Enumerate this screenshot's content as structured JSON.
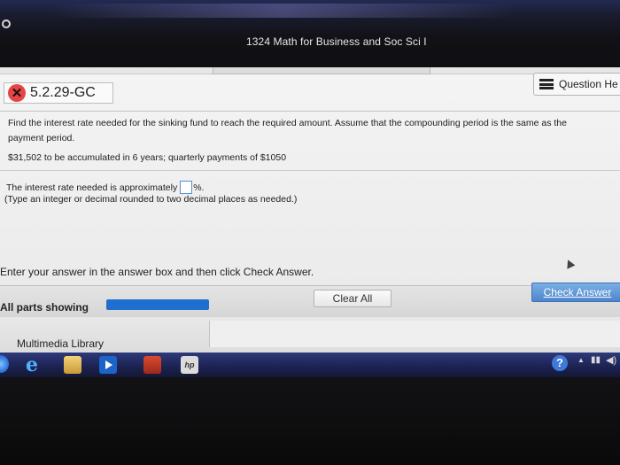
{
  "window": {
    "course_title": "1324 Math for Business and Soc Sci I"
  },
  "question": {
    "id": "5.2.29-GC",
    "status_icon": "x-circle-icon",
    "help_label": "Question He",
    "instruction_line1": "Find the interest rate needed for the sinking fund to reach the required amount.  Assume that the compounding period is the same as the",
    "instruction_line2": "payment period.",
    "given": "$31,502 to be accumulated in 6 years; quarterly payments of $1050",
    "answer_prefix": "The interest rate needed is approximately",
    "answer_value": "",
    "answer_suffix": "%.",
    "hint": "(Type an integer or decimal rounded to two decimal places as needed.)"
  },
  "footer": {
    "enter_message": "Enter your answer in the answer box and then click Check Answer.",
    "parts_label": "All parts showing",
    "progress_fraction": 1.0,
    "clear_label": "Clear All",
    "check_label": "Check Answer",
    "media_label": "Multimedia Library"
  },
  "taskbar": {
    "icons": [
      "start-orb-icon",
      "internet-explorer-icon",
      "file-explorer-icon",
      "media-player-icon",
      "folder-icon",
      "hp-icon"
    ],
    "tray": [
      "help-icon",
      "chevron-up-icon",
      "network-icon",
      "volume-icon"
    ]
  },
  "colors": {
    "accent_blue": "#1f6fd1",
    "error_red": "#e64545",
    "check_button": "#4f86cb"
  }
}
